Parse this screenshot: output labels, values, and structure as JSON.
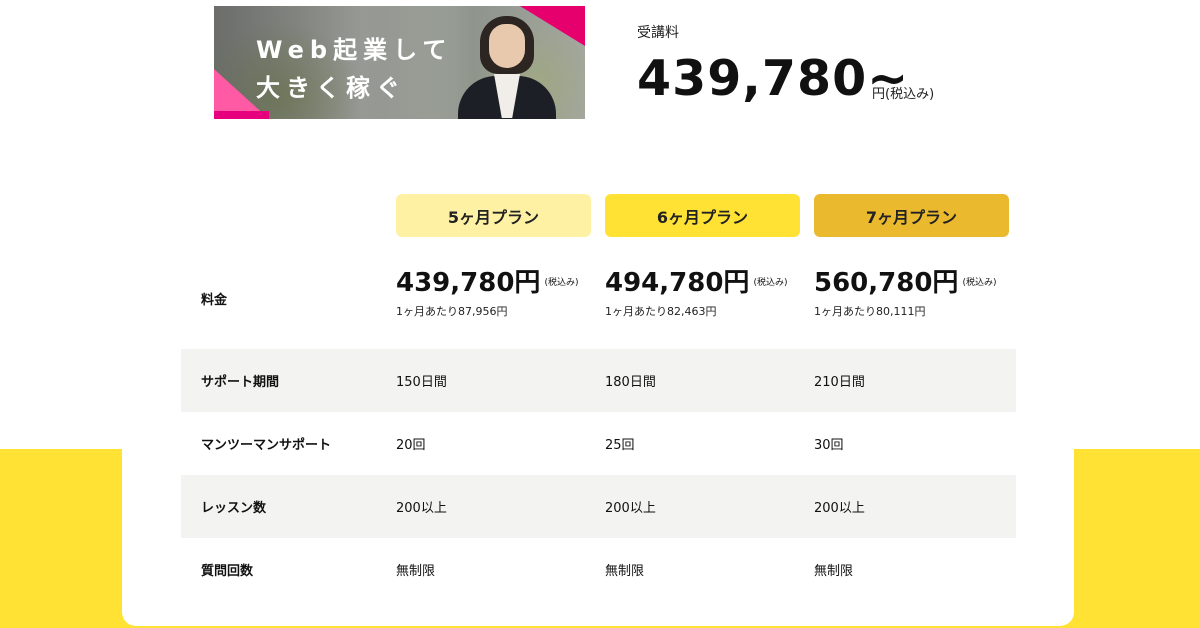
{
  "banner": {
    "line1": "Web起業して",
    "line2": "大きく稼ぐ"
  },
  "price_header": {
    "label": "受講料",
    "amount": "439,780~",
    "unit": "円(税込み)"
  },
  "plans": [
    {
      "label": "5ヶ月プラン",
      "color": "#fff1a3",
      "price": "439,780円",
      "tax": "(税込み)",
      "monthly": "1ヶ月あたり87,956円",
      "support_period": "150日間",
      "mentor_support": "20回",
      "lessons": "200以上",
      "questions": "無制限"
    },
    {
      "label": "6ヶ月プラン",
      "color": "#ffe234",
      "price": "494,780円",
      "tax": "(税込み)",
      "monthly": "1ヶ月あたり82,463円",
      "support_period": "180日間",
      "mentor_support": "25回",
      "lessons": "200以上",
      "questions": "無制限"
    },
    {
      "label": "7ヶ月プラン",
      "color": "#ebb92e",
      "price": "560,780円",
      "tax": "(税込み)",
      "monthly": "1ヶ月あたり80,111円",
      "support_period": "210日間",
      "mentor_support": "30回",
      "lessons": "200以上",
      "questions": "無制限"
    }
  ],
  "row_labels": {
    "fee": "料金",
    "support_period": "サポート期間",
    "mentor_support": "マンツーマンサポート",
    "lessons": "レッスン数",
    "questions": "質問回数"
  },
  "colors": {
    "accent_yellow": "#ffe234",
    "row_shade": "#f3f3f1",
    "banner_pink": "#e6007e"
  }
}
